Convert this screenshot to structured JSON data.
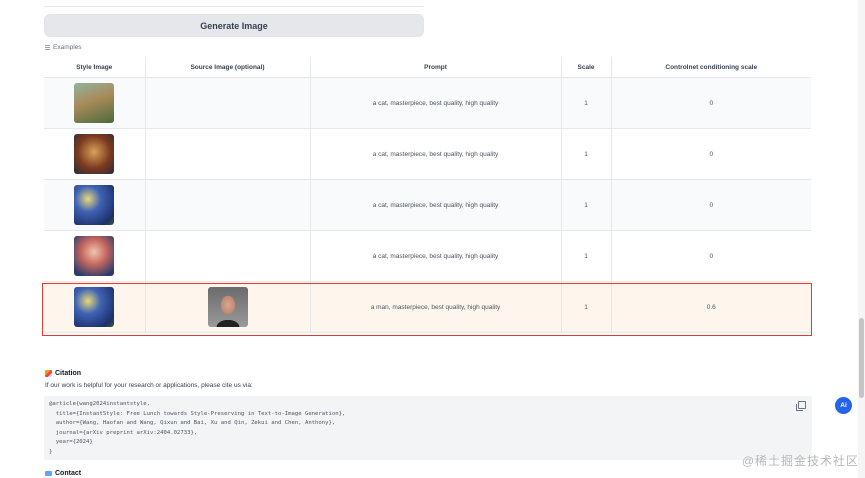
{
  "generate_button": {
    "label": "Generate Image"
  },
  "examples": {
    "label": "Examples",
    "headers": [
      "Style Image",
      "Source Image (optional)",
      "Prompt",
      "Scale",
      "Controlnet conditioning scale"
    ],
    "rows": [
      {
        "style_image": "style-image-thumbnail",
        "source_image": "",
        "prompt": "a cat, masterpiece, best quality, high quality",
        "scale": "1",
        "controlnet_scale": "0"
      },
      {
        "style_image": "style-image-thumbnail",
        "source_image": "",
        "prompt": "a cat, masterpiece, best quality, high quality",
        "scale": "1",
        "controlnet_scale": "0"
      },
      {
        "style_image": "style-image-thumbnail",
        "source_image": "",
        "prompt": "a cat, masterpiece, best quality, high quality",
        "scale": "1",
        "controlnet_scale": "0"
      },
      {
        "style_image": "style-image-thumbnail",
        "source_image": "",
        "prompt": "a cat, masterpiece, best quality, high quality",
        "scale": "1",
        "controlnet_scale": "0"
      },
      {
        "style_image": "style-image-thumbnail",
        "source_image": "portrait-photo",
        "prompt": "a man, masterpiece, best quality, high quality",
        "scale": "1",
        "controlnet_scale": "0.6"
      }
    ],
    "highlight_color": "#e53935"
  },
  "citation": {
    "title": "Citation",
    "description": "If our work is helpful for your research or applications, please cite us via:",
    "code_lines": [
      "@article{wang2024instantstyle,",
      "  title={InstantStyle: Free Lunch towards Style-Preserving in Text-to-Image Generation},",
      "  author={Wang, Haofan and Wang, Qixun and Bai, Xu and Qin, Zekui and Chen, Anthony},",
      "  journal={arXiv preprint arXiv:2404.02733},",
      "  year={2024}",
      "}"
    ]
  },
  "contact": {
    "title": "Contact"
  },
  "ai_button": {
    "label": "Ai"
  },
  "watermark": "@稀土掘金技术社区"
}
